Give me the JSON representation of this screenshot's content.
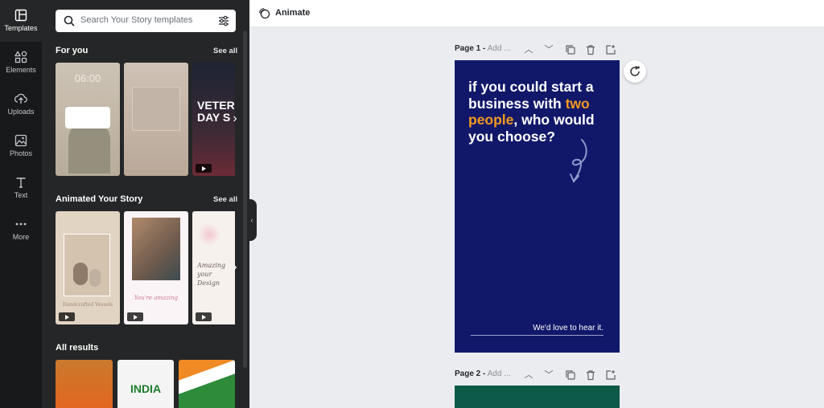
{
  "rail": {
    "items": [
      {
        "label": "Templates",
        "icon": "templates-icon"
      },
      {
        "label": "Elements",
        "icon": "elements-icon"
      },
      {
        "label": "Uploads",
        "icon": "uploads-icon"
      },
      {
        "label": "Photos",
        "icon": "photos-icon"
      },
      {
        "label": "Text",
        "icon": "text-icon"
      },
      {
        "label": "More",
        "icon": "more-icon"
      }
    ]
  },
  "search": {
    "placeholder": "Search Your Story templates"
  },
  "sections": {
    "for_you": {
      "title": "For you",
      "see_all": "See all",
      "thumbs": [
        {
          "clock": "06:00"
        },
        {},
        {
          "text": "VETERA DAY S"
        }
      ]
    },
    "animated": {
      "title": "Animated Your Story",
      "see_all": "See all",
      "thumbs": [
        {
          "caption": "Handcrafted Vessels"
        },
        {
          "caption": "You're amazing"
        },
        {
          "caption": "Amazing your Design"
        }
      ]
    },
    "all_results": {
      "title": "All results",
      "thumbs": [
        {},
        {
          "text": "INDIA"
        },
        {}
      ]
    }
  },
  "topbar": {
    "animate_label": "Animate"
  },
  "pages": [
    {
      "label": "Page 1 -",
      "add_title": "Add ..."
    },
    {
      "label": "Page 2 -",
      "add_title": "Add ..."
    }
  ],
  "design": {
    "headline_pre": "if you could start a business with ",
    "headline_highlight": "two people",
    "headline_post": ", who would you choose?",
    "footer": "We'd love to hear it.",
    "colors": {
      "background": "#11186a",
      "highlight": "#f49a1f",
      "page2_background": "#0e5a48"
    }
  }
}
